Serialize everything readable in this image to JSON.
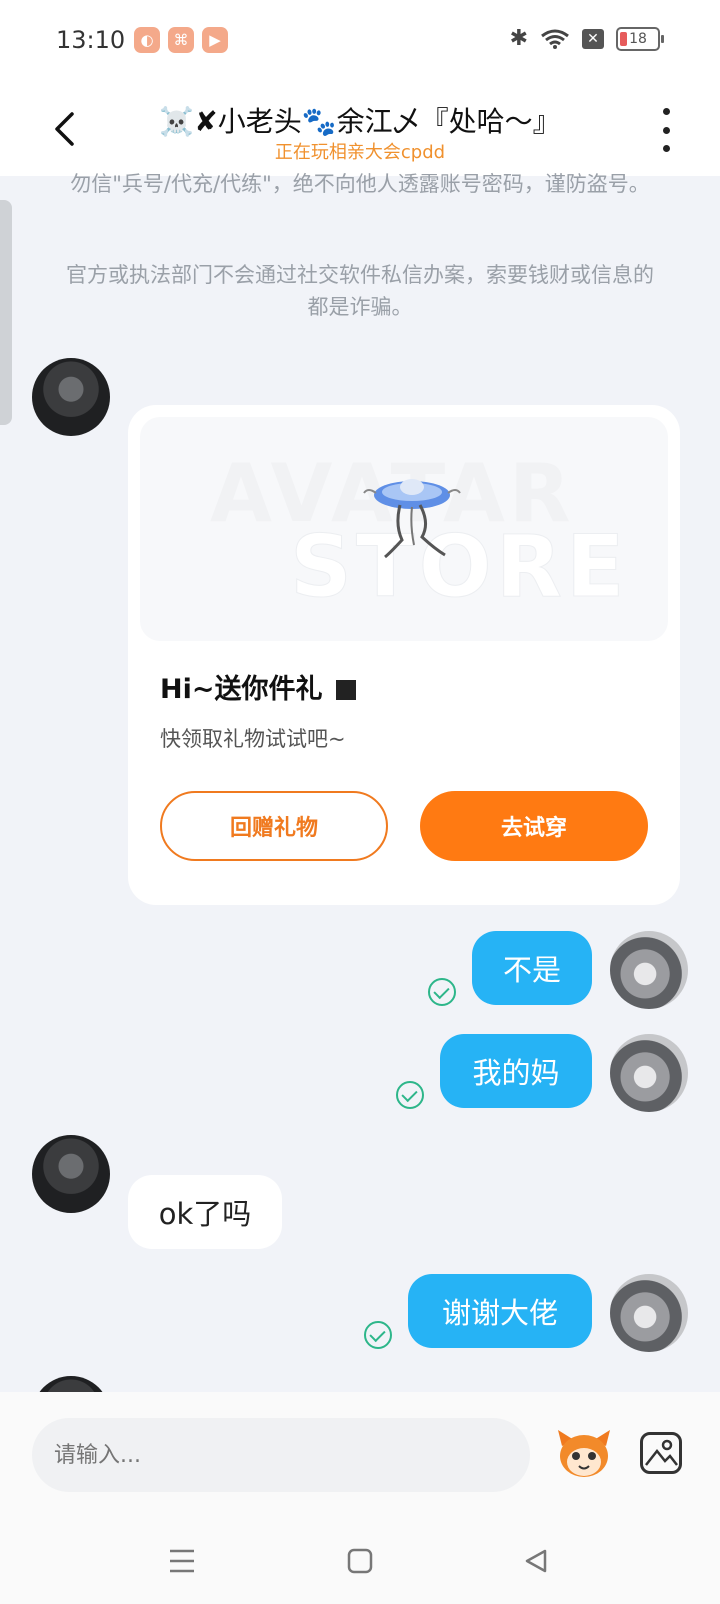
{
  "status_bar": {
    "time": "13:10",
    "battery": "18",
    "icons": [
      "app-icon-1",
      "app-icon-2",
      "app-icon-3",
      "bluetooth-icon",
      "wifi-icon",
      "sim-off-icon",
      "battery-icon"
    ]
  },
  "header": {
    "title": "☠️✘小老头🐾余江乄『处哈～』",
    "subtitle": "正在玩相亲大会cpdd"
  },
  "notices": [
    "勿信\"兵号/代充/代练\"，绝不向他人透露账号密码，谨防盗号。",
    "官方或执法部门不会通过社交软件私信办案，索要钱财或信息的都是诈骗。"
  ],
  "gift_card": {
    "watermark_top": "AVATAR",
    "watermark_bottom": "STORE",
    "title": "Hi~送你件礼",
    "description": "快领取礼物试试吧~",
    "return_gift_button": "回赠礼物",
    "try_on_button": "去试穿"
  },
  "messages": [
    {
      "sender": "me",
      "text": "不是",
      "read": true
    },
    {
      "sender": "me",
      "text": "我的妈",
      "read": true
    },
    {
      "sender": "peer",
      "text": "ok了吗"
    },
    {
      "sender": "me",
      "text": "谢谢大佬",
      "read": true
    }
  ],
  "input": {
    "placeholder": "请输入..."
  },
  "colors": {
    "accent_orange": "#ff7a12",
    "bubble_blue": "#26b3f5",
    "read_check_green": "#2db68a",
    "subtitle_orange": "#f0912e"
  }
}
